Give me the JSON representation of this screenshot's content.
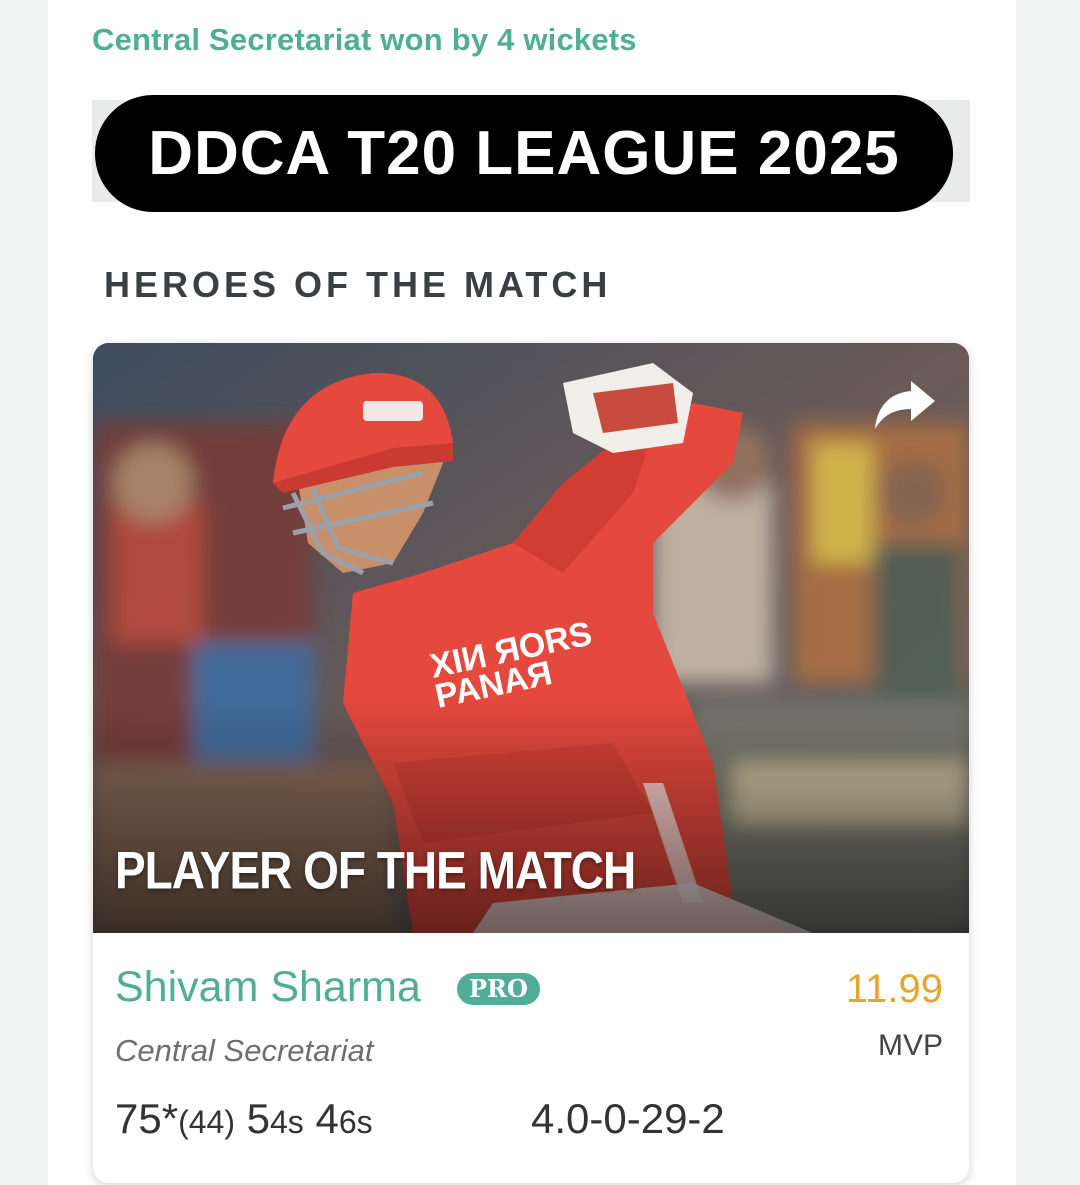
{
  "match": {
    "result": "Central Secretariat won by 4 wickets",
    "banner": "DDCA T20 LEAGUE 2025"
  },
  "section": {
    "title": "HEROES OF THE MATCH"
  },
  "hero_card": {
    "photo_label": "PLAYER OF THE MATCH",
    "share_icon": "share-arrow-icon",
    "player_name": "Shivam Sharma",
    "badge": "PRO",
    "team": "Central Secretariat",
    "mvp_value": "11.99",
    "mvp_label": "MVP",
    "batting": {
      "runs": "75*",
      "balls": "(44)",
      "fours_count": "5",
      "fours_label": "4s",
      "sixes_count": "4",
      "sixes_label": "6s"
    },
    "bowling": "4.0-0-29-2"
  },
  "colors": {
    "accent": "#4fae95",
    "mvp": "#e8a52e",
    "jersey": "#e5493d"
  }
}
